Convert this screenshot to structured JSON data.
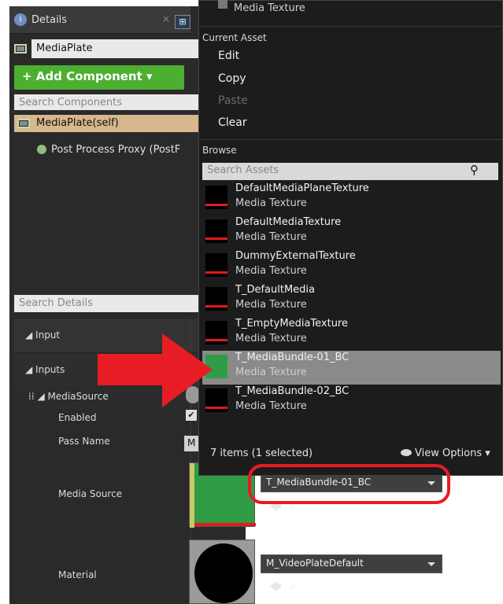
{
  "details_panel": {
    "tab_title": "Details",
    "tab_close": "×",
    "tab2_icon": "⊞",
    "object_name": "MediaPlate",
    "add_component_label": "+ Add Component ▾",
    "search_components_placeholder": "Search Components",
    "self_row": "MediaPlate(self)",
    "child_component": "Post Process Proxy (PostF",
    "search_details_placeholder": "Search Details",
    "sections": [
      {
        "label": "◢ Input"
      },
      {
        "label": "◢ Inputs"
      },
      {
        "label": "⁞⁞ ◢ MediaSource"
      }
    ],
    "props": {
      "enabled": "Enabled",
      "pass_name": "Pass Name",
      "pass_name_value": "M",
      "media_source": "Media Source",
      "media_source_value": "T_MediaBundle-01_BC",
      "material": "Material",
      "material_value": "M_VideoPlateDefault"
    }
  },
  "dropdown_menu": {
    "top_partial_item": "Media Texture",
    "current_asset_header": "Current Asset",
    "items": [
      {
        "label": "Edit",
        "enabled": true
      },
      {
        "label": "Copy",
        "enabled": true
      },
      {
        "label": "Paste",
        "enabled": false
      },
      {
        "label": "Clear",
        "enabled": true
      }
    ],
    "browse_header": "Browse",
    "search_assets_placeholder": "Search Assets",
    "assets": [
      {
        "name": "DefaultMediaPlaneTexture",
        "type": "Media Texture",
        "selected": false
      },
      {
        "name": "DefaultMediaTexture",
        "type": "Media Texture",
        "selected": false
      },
      {
        "name": "DummyExternalTexture",
        "type": "Media Texture",
        "selected": false
      },
      {
        "name": "T_DefaultMedia",
        "type": "Media Texture",
        "selected": false
      },
      {
        "name": "T_EmptyMediaTexture",
        "type": "Media Texture",
        "selected": false
      },
      {
        "name": "T_MediaBundle-01_BC",
        "type": "Media Texture",
        "selected": true
      },
      {
        "name": "T_MediaBundle-02_BC",
        "type": "Media Texture",
        "selected": false
      }
    ],
    "footer_count": "7 items (1 selected)",
    "view_options": "View Options ▾"
  },
  "colors": {
    "add_button": "#4caf30",
    "selection_row": "#d6b78e",
    "annotation_red": "#e81c24",
    "selected_asset": "#8a8a8a"
  }
}
